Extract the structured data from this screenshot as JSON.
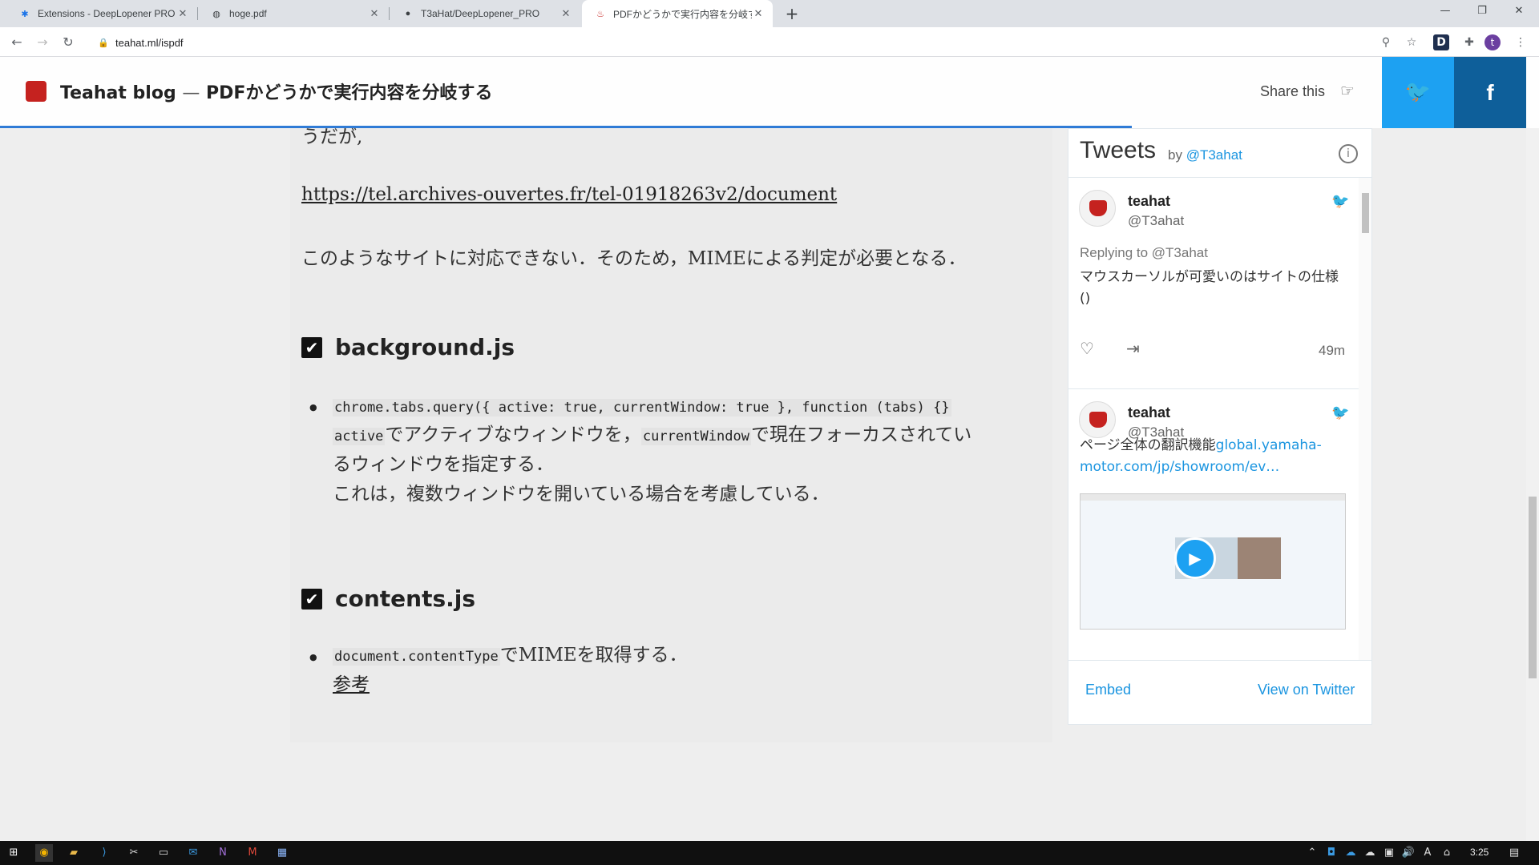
{
  "browser": {
    "tabs": [
      {
        "title": "Extensions - DeepLopener PRO",
        "favicon": "puzzle-icon"
      },
      {
        "title": "hoge.pdf",
        "favicon": "globe-icon"
      },
      {
        "title": "T3aHat/DeepLopener_PRO",
        "favicon": "github-icon"
      },
      {
        "title": "PDFかどうかで実行内容を分岐する",
        "favicon": "teapot-icon"
      }
    ],
    "url": "teahat.ml/ispdf",
    "profile_initial": "t"
  },
  "header": {
    "blog_name": "Teahat blog",
    "separator": "—",
    "post_title": "PDFかどうかで実行内容を分岐する",
    "share_label": "Share this",
    "twitter_glyph": "🐦",
    "facebook_glyph": "f",
    "accent_color": "#2f7bd6"
  },
  "article": {
    "partial_line": "うだが,",
    "url_text": "https://tel.archives-ouvertes.fr/tel-01918263v2/document",
    "mime_note": "このようなサイトに対応できない．そのため，MIMEによる判定が必要となる．",
    "sections": [
      {
        "heading": "background.js",
        "code_line": "chrome.tabs.query({ active: true, currentWindow: true }, function (tabs) {}",
        "code_active": "active",
        "text1": "でアクティブなウィンドウを，",
        "code_current": "currentWindow",
        "text2": "で現在フォーカスされてい",
        "text3": "るウィンドウを指定する．",
        "text4": "これは，複数ウィンドウを開いている場合を考慮している．"
      },
      {
        "heading": "contents.js",
        "code_doc": "document.contentType",
        "text1": "でMIMEを取得する．",
        "ref_link": "参考"
      }
    ]
  },
  "twitter": {
    "title": "Tweets",
    "by": "by",
    "handle": "@T3ahat",
    "tweets": [
      {
        "name": "teahat",
        "handle": "@T3ahat",
        "replying": "Replying to @T3ahat",
        "body": "マウスカーソルが可愛いのはサイトの仕様()",
        "time": "49m"
      },
      {
        "name": "teahat",
        "handle": "@T3ahat",
        "body_prefix": "ページ全体の翻訳機能",
        "body_link": "global.yamaha-motor.com/jp/showroom/ev…"
      }
    ],
    "embed": "Embed",
    "view": "View on Twitter"
  },
  "taskbar": {
    "time": "3:25"
  }
}
